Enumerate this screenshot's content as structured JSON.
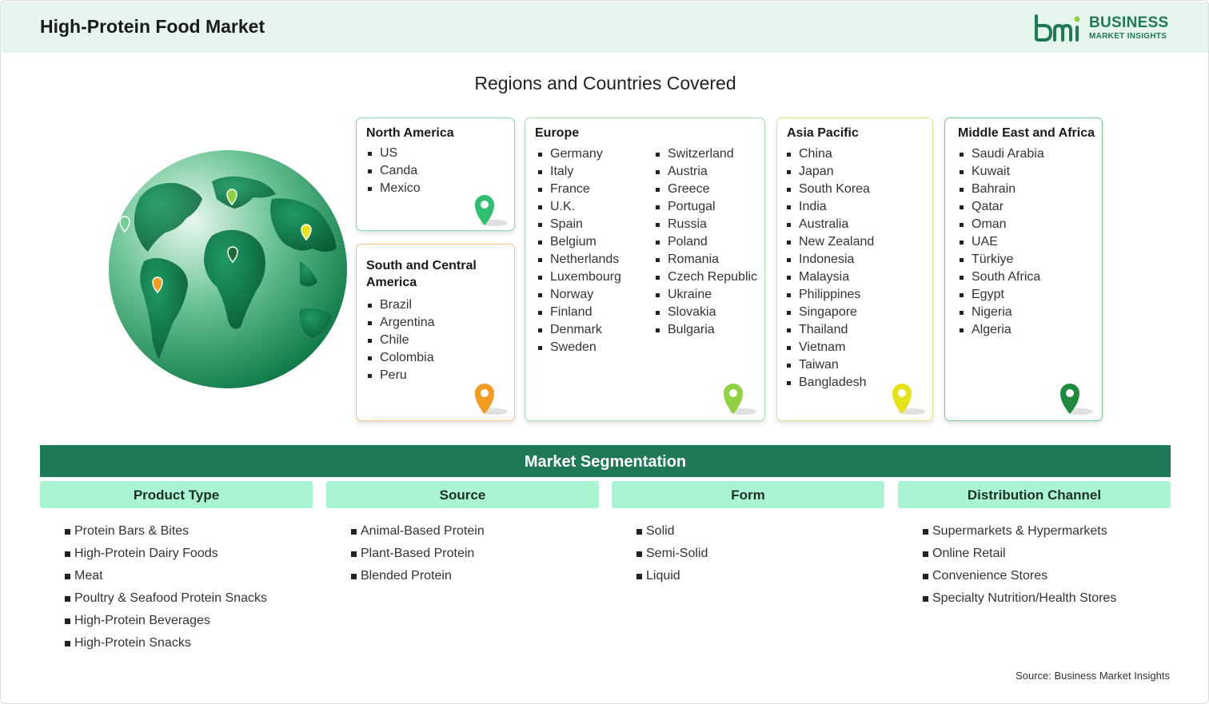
{
  "header": {
    "title": "High-Protein Food Market"
  },
  "logo": {
    "name": "BUSINESS",
    "subtitle": "MARKET INSIGHTS"
  },
  "regions_title": "Regions and Countries Covered",
  "regions": {
    "north_america": {
      "title": "North America",
      "items": [
        "US",
        "Canda",
        "Mexico"
      ],
      "pin_color": "#2fbf71"
    },
    "south_central_america": {
      "title": "South and Central America",
      "items": [
        "Brazil",
        "Argentina",
        "Chile",
        "Colombia",
        "Peru"
      ],
      "pin_color": "#f39c1f"
    },
    "europe": {
      "title": "Europe",
      "col1": [
        "Germany",
        "Italy",
        "France",
        "U.K.",
        "Spain",
        "Belgium",
        "Netherlands",
        "Luxembourg",
        "Norway",
        "Finland",
        "Denmark",
        "Sweden"
      ],
      "col2": [
        "Switzerland",
        "Austria",
        "Greece",
        "Portugal",
        "Russia",
        "Poland",
        "Romania",
        "Czech Republic",
        "Ukraine",
        "Slovakia",
        "Bulgaria"
      ],
      "pin_color": "#8fd13f"
    },
    "asia_pacific": {
      "title": "Asia Pacific",
      "items": [
        "China",
        "Japan",
        "South Korea",
        "India",
        "Australia",
        "New Zealand",
        "Indonesia",
        "Malaysia",
        "Philippines",
        "Singapore",
        "Thailand",
        "Vietnam",
        "Taiwan",
        "Bangladesh"
      ],
      "pin_color": "#e8e21c"
    },
    "middle_east_africa": {
      "title": "Middle East and Africa",
      "items": [
        "Saudi Arabia",
        "Kuwait",
        "Bahrain",
        "Qatar",
        "Oman",
        "UAE",
        "Türkiye",
        "South Africa",
        "Egypt",
        "Nigeria",
        "Algeria"
      ],
      "pin_color": "#1e8a3c"
    }
  },
  "segmentation": {
    "title": "Market Segmentation",
    "columns": [
      {
        "title": "Product Type",
        "items": [
          "Protein Bars & Bites",
          "High-Protein Dairy Foods",
          "Meat",
          "Poultry & Seafood Protein Snacks",
          "High-Protein Beverages",
          "High-Protein Snacks"
        ]
      },
      {
        "title": "Source",
        "items": [
          "Animal-Based Protein",
          "Plant-Based Protein",
          "Blended Protein"
        ]
      },
      {
        "title": "Form",
        "items": [
          "Solid",
          "Semi-Solid",
          "Liquid"
        ]
      },
      {
        "title": "Distribution Channel",
        "items": [
          "Supermarkets & Hypermarkets",
          "Online Retail",
          "Convenience Stores",
          "Specialty Nutrition/Health Stores"
        ]
      }
    ]
  },
  "source": "Source: Business Market Insights",
  "colors": {
    "brand_green": "#1e7a56",
    "header_bg": "#e6f6ee",
    "segment_head_bg": "#a9f5d3"
  }
}
